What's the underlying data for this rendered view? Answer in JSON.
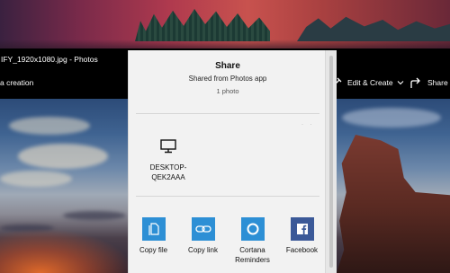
{
  "window": {
    "title": "IFY_1920x1080.jpg - Photos"
  },
  "toolbar": {
    "left_label": "a creation",
    "edit_create_label": "Edit & Create",
    "share_label": "Share"
  },
  "share_panel": {
    "title": "Share",
    "subtitle": "Shared from Photos app",
    "count": "1 photo",
    "device": {
      "label_line1": "DESKTOP-",
      "label_line2": "QEK2AAA",
      "icon": "monitor-icon"
    },
    "apps": [
      {
        "label": "Copy file",
        "icon": "copy-file-icon",
        "color": "#2d8fd5"
      },
      {
        "label": "Copy link",
        "icon": "copy-link-icon",
        "color": "#2d8fd5"
      },
      {
        "label_line1": "Cortana",
        "label_line2": "Reminders",
        "icon": "cortana-icon",
        "color": "#2d8fd5"
      },
      {
        "label": "Facebook",
        "icon": "facebook-icon",
        "color": "#3b5998"
      }
    ]
  }
}
